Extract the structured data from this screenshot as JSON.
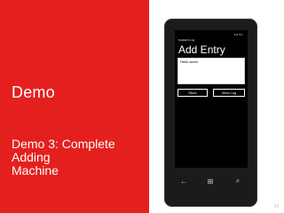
{
  "slide": {
    "heading": "Demo",
    "subtitle": "Demo 3: Complete\nAdding\nMachine",
    "page_number": "24"
  },
  "phone": {
    "app_name": "Captain's Log",
    "status": "10:51",
    "page_title": "Add Entry",
    "entry_text": "Hello world",
    "store_label": "Store",
    "view_log_label": "View Log",
    "nav": {
      "back_icon": "←",
      "start_icon": "⊞",
      "search_icon": "⌕"
    }
  },
  "colors": {
    "accent": "#e3201e",
    "phone_body": "#1b1b1b",
    "screen": "#000000"
  }
}
